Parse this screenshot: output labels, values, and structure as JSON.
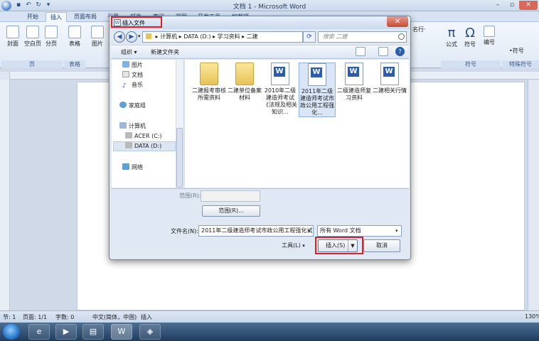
{
  "app": {
    "title": "文档 1 - Microsoft Word",
    "tabs": [
      "开始",
      "插入",
      "页面布局",
      "引用",
      "邮件",
      "审阅",
      "视图",
      "开发工具",
      "加载项"
    ],
    "active_tab": "插入",
    "ribbon": {
      "buttons": [
        "封面",
        "空白页",
        "分页",
        "表格",
        "图片",
        "公式",
        "符号",
        "编号"
      ],
      "group_labels": [
        "页",
        "表格",
        "符号",
        "特殊符号"
      ],
      "right_partial": [
        "名行·",
        "•符号"
      ]
    }
  },
  "dialog": {
    "title": "插入文件",
    "address": {
      "segments": [
        "计算机",
        "DATA (D:)",
        "学习资料",
        "二建"
      ],
      "separator": "▸"
    },
    "search_placeholder": "搜索 二建",
    "toolbar": {
      "organize": "组织 ▾",
      "new_folder": "新建文件夹"
    },
    "nav": {
      "items": [
        "图片",
        "文档",
        "音乐",
        "家庭组",
        "计算机",
        "ACER (C:)",
        "DATA (D:)",
        "网络"
      ],
      "selected": "DATA (D:)"
    },
    "files": [
      {
        "name": "二建报考审核所需资料",
        "kind": "folder"
      },
      {
        "name": "二建单位备案材料",
        "kind": "folder"
      },
      {
        "name": "2010年二级建造师考试《法规及相关知识...",
        "kind": "doc"
      },
      {
        "name": "2011年二级建造师考试市政公用工程强化...",
        "kind": "doc",
        "selected": true
      },
      {
        "name": "二级建造师复习资料",
        "kind": "doc"
      },
      {
        "name": "二建相关行情",
        "kind": "doc"
      }
    ],
    "range_label": "范围(R):",
    "range_button": "范围(R)...",
    "filename_label": "文件名(N):",
    "filename_value": "2011年二级建造师考试市政公用工程强化试",
    "filetype_value": "所有 Word 文档",
    "tools_label": "工具(L)",
    "insert_button": "插入(S)",
    "cancel_button": "取消"
  },
  "status": {
    "section": "节: 1",
    "page": "页面: 1/1",
    "words": "字数: 0",
    "language": "中文(简体，中国)",
    "mode": "插入",
    "zoom": "130%"
  },
  "colors": {
    "highlight": "#e02020",
    "accent": "#2b5cae"
  }
}
